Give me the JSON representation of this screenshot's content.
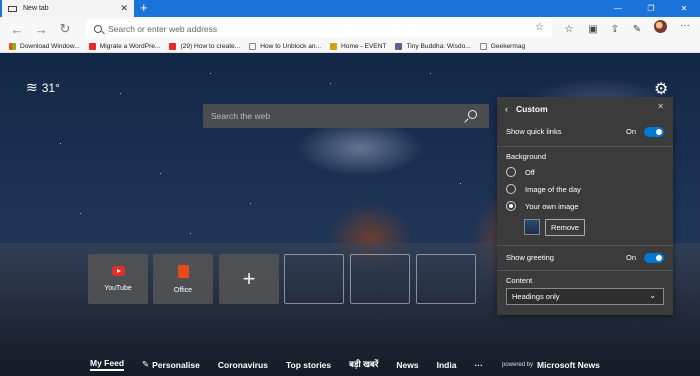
{
  "browser": {
    "tab_title": "New tab",
    "new_tab": "+",
    "window_controls": [
      "—",
      "❐",
      "✕"
    ],
    "address_placeholder": "Search or enter web address"
  },
  "favorites": [
    {
      "label": "Download Window...",
      "icon": "windows-logo-icon",
      "color": "#f25022"
    },
    {
      "label": "Migrate a WordPre...",
      "icon": "youtube-icon",
      "color": "#e52d27"
    },
    {
      "label": "(29) How to create...",
      "icon": "youtube-icon",
      "color": "#e52d27"
    },
    {
      "label": "How to Unblock an...",
      "icon": "page-icon",
      "color": "#888888"
    },
    {
      "label": "Home - EVENT",
      "icon": "event-icon",
      "color": "#d4a017"
    },
    {
      "label": "Tiny Buddha: Wisdo...",
      "icon": "buddha-icon",
      "color": "#6b5b95"
    },
    {
      "label": "Geekermag",
      "icon": "page-icon",
      "color": "#888888"
    }
  ],
  "weather": {
    "temp": "31°",
    "icon": "haze-icon"
  },
  "search": {
    "placeholder": "Search the web"
  },
  "quick_links": [
    {
      "label": "YouTube",
      "icon": "youtube-icon"
    },
    {
      "label": "Office",
      "icon": "office-icon"
    },
    {
      "label": "+",
      "icon": "add-icon"
    }
  ],
  "bottom_nav": {
    "items": [
      "My Feed",
      "Personalise",
      "Coronavirus",
      "Top stories",
      "बड़ी खबरें",
      "News",
      "India",
      "···"
    ],
    "active": "My Feed",
    "powered_by": "powered by",
    "provider": "Microsoft News"
  },
  "custom_panel": {
    "title": "Custom",
    "show_quick_links_label": "Show quick links",
    "show_quick_links_state": "On",
    "background_heading": "Background",
    "background_options": [
      "Off",
      "Image of the day",
      "Your own image"
    ],
    "background_selected": "Your own image",
    "remove_label": "Remove",
    "show_greeting_label": "Show greeting",
    "show_greeting_state": "On",
    "content_heading": "Content",
    "content_value": "Headings only"
  },
  "colors": {
    "accent": "#0078d4",
    "titlebar": "#1a73d9",
    "panel": "#3b3b3b"
  }
}
